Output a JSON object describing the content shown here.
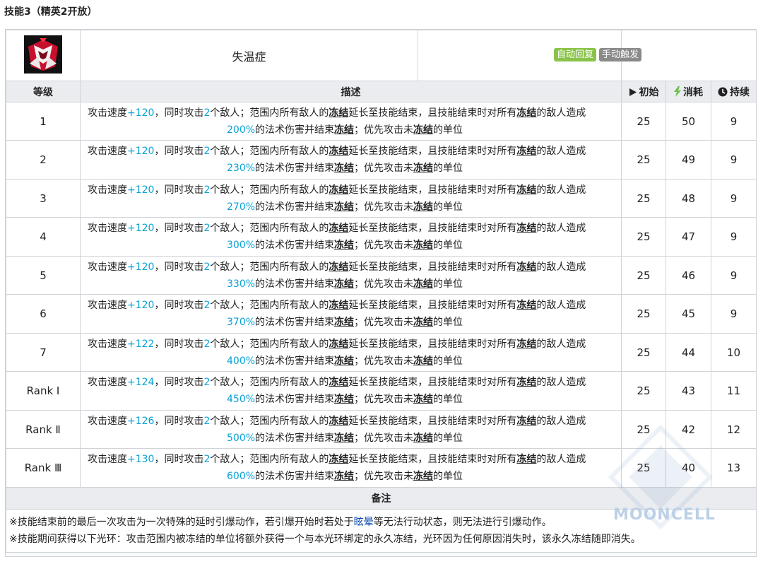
{
  "section_title": "技能3（精英2开放）",
  "skill": {
    "name": "失温症",
    "icon": "skill-icon",
    "tags": [
      {
        "label": "自动回复",
        "color": "#8bc34a"
      },
      {
        "label": "手动触发",
        "color": "#8a8a8a"
      }
    ]
  },
  "table_headers": {
    "level": "等级",
    "description": "描述",
    "initial": "初始",
    "cost": "消耗",
    "duration": "持续"
  },
  "header_icons": {
    "initial": "play-icon",
    "cost": "lightning-icon",
    "duration": "clock-icon"
  },
  "desc_text": {
    "p1": "攻击速度",
    "p3": "，同时攻击",
    "p4": "2",
    "p5": "个敌人；范围内所有敌人的",
    "frozen": "冻结",
    "p6": "延长至技能结束，且技能结束时对所有",
    "p7": "的敌人造成",
    "p9": "的法术伤害并结束",
    "p10": "；优先攻击未",
    "p11": "的单位"
  },
  "levels": [
    {
      "level": "1",
      "atk_speed": "+120",
      "damage": "200%",
      "initial": "25",
      "cost": "50",
      "duration": "9"
    },
    {
      "level": "2",
      "atk_speed": "+120",
      "damage": "230%",
      "initial": "25",
      "cost": "49",
      "duration": "9"
    },
    {
      "level": "3",
      "atk_speed": "+120",
      "damage": "270%",
      "initial": "25",
      "cost": "48",
      "duration": "9"
    },
    {
      "level": "4",
      "atk_speed": "+120",
      "damage": "300%",
      "initial": "25",
      "cost": "47",
      "duration": "9"
    },
    {
      "level": "5",
      "atk_speed": "+120",
      "damage": "330%",
      "initial": "25",
      "cost": "46",
      "duration": "9"
    },
    {
      "level": "6",
      "atk_speed": "+120",
      "damage": "370%",
      "initial": "25",
      "cost": "45",
      "duration": "9"
    },
    {
      "level": "7",
      "atk_speed": "+122",
      "damage": "400%",
      "initial": "25",
      "cost": "44",
      "duration": "10"
    },
    {
      "level": "Rank Ⅰ",
      "atk_speed": "+124",
      "damage": "450%",
      "initial": "25",
      "cost": "43",
      "duration": "11"
    },
    {
      "level": "Rank Ⅱ",
      "atk_speed": "+126",
      "damage": "500%",
      "initial": "25",
      "cost": "42",
      "duration": "12"
    },
    {
      "level": "Rank Ⅲ",
      "atk_speed": "+130",
      "damage": "600%",
      "initial": "25",
      "cost": "40",
      "duration": "13"
    }
  ],
  "notes": {
    "title": "备注",
    "line1_a": "※技能结束前的最后一次攻击为一次特殊的延时引爆动作，若引爆开始时若处于",
    "line1_link": "眩晕",
    "line1_b": "等无法行动状态，则无法进行引爆动作。",
    "line2": "※技能期间获得以下光环：攻击范围内被冻结的单位将额外获得一个与本光环绑定的永久冻结，光环因为任何原因消失时，该永久冻结随即消失。"
  },
  "watermark": "MOONCELL"
}
